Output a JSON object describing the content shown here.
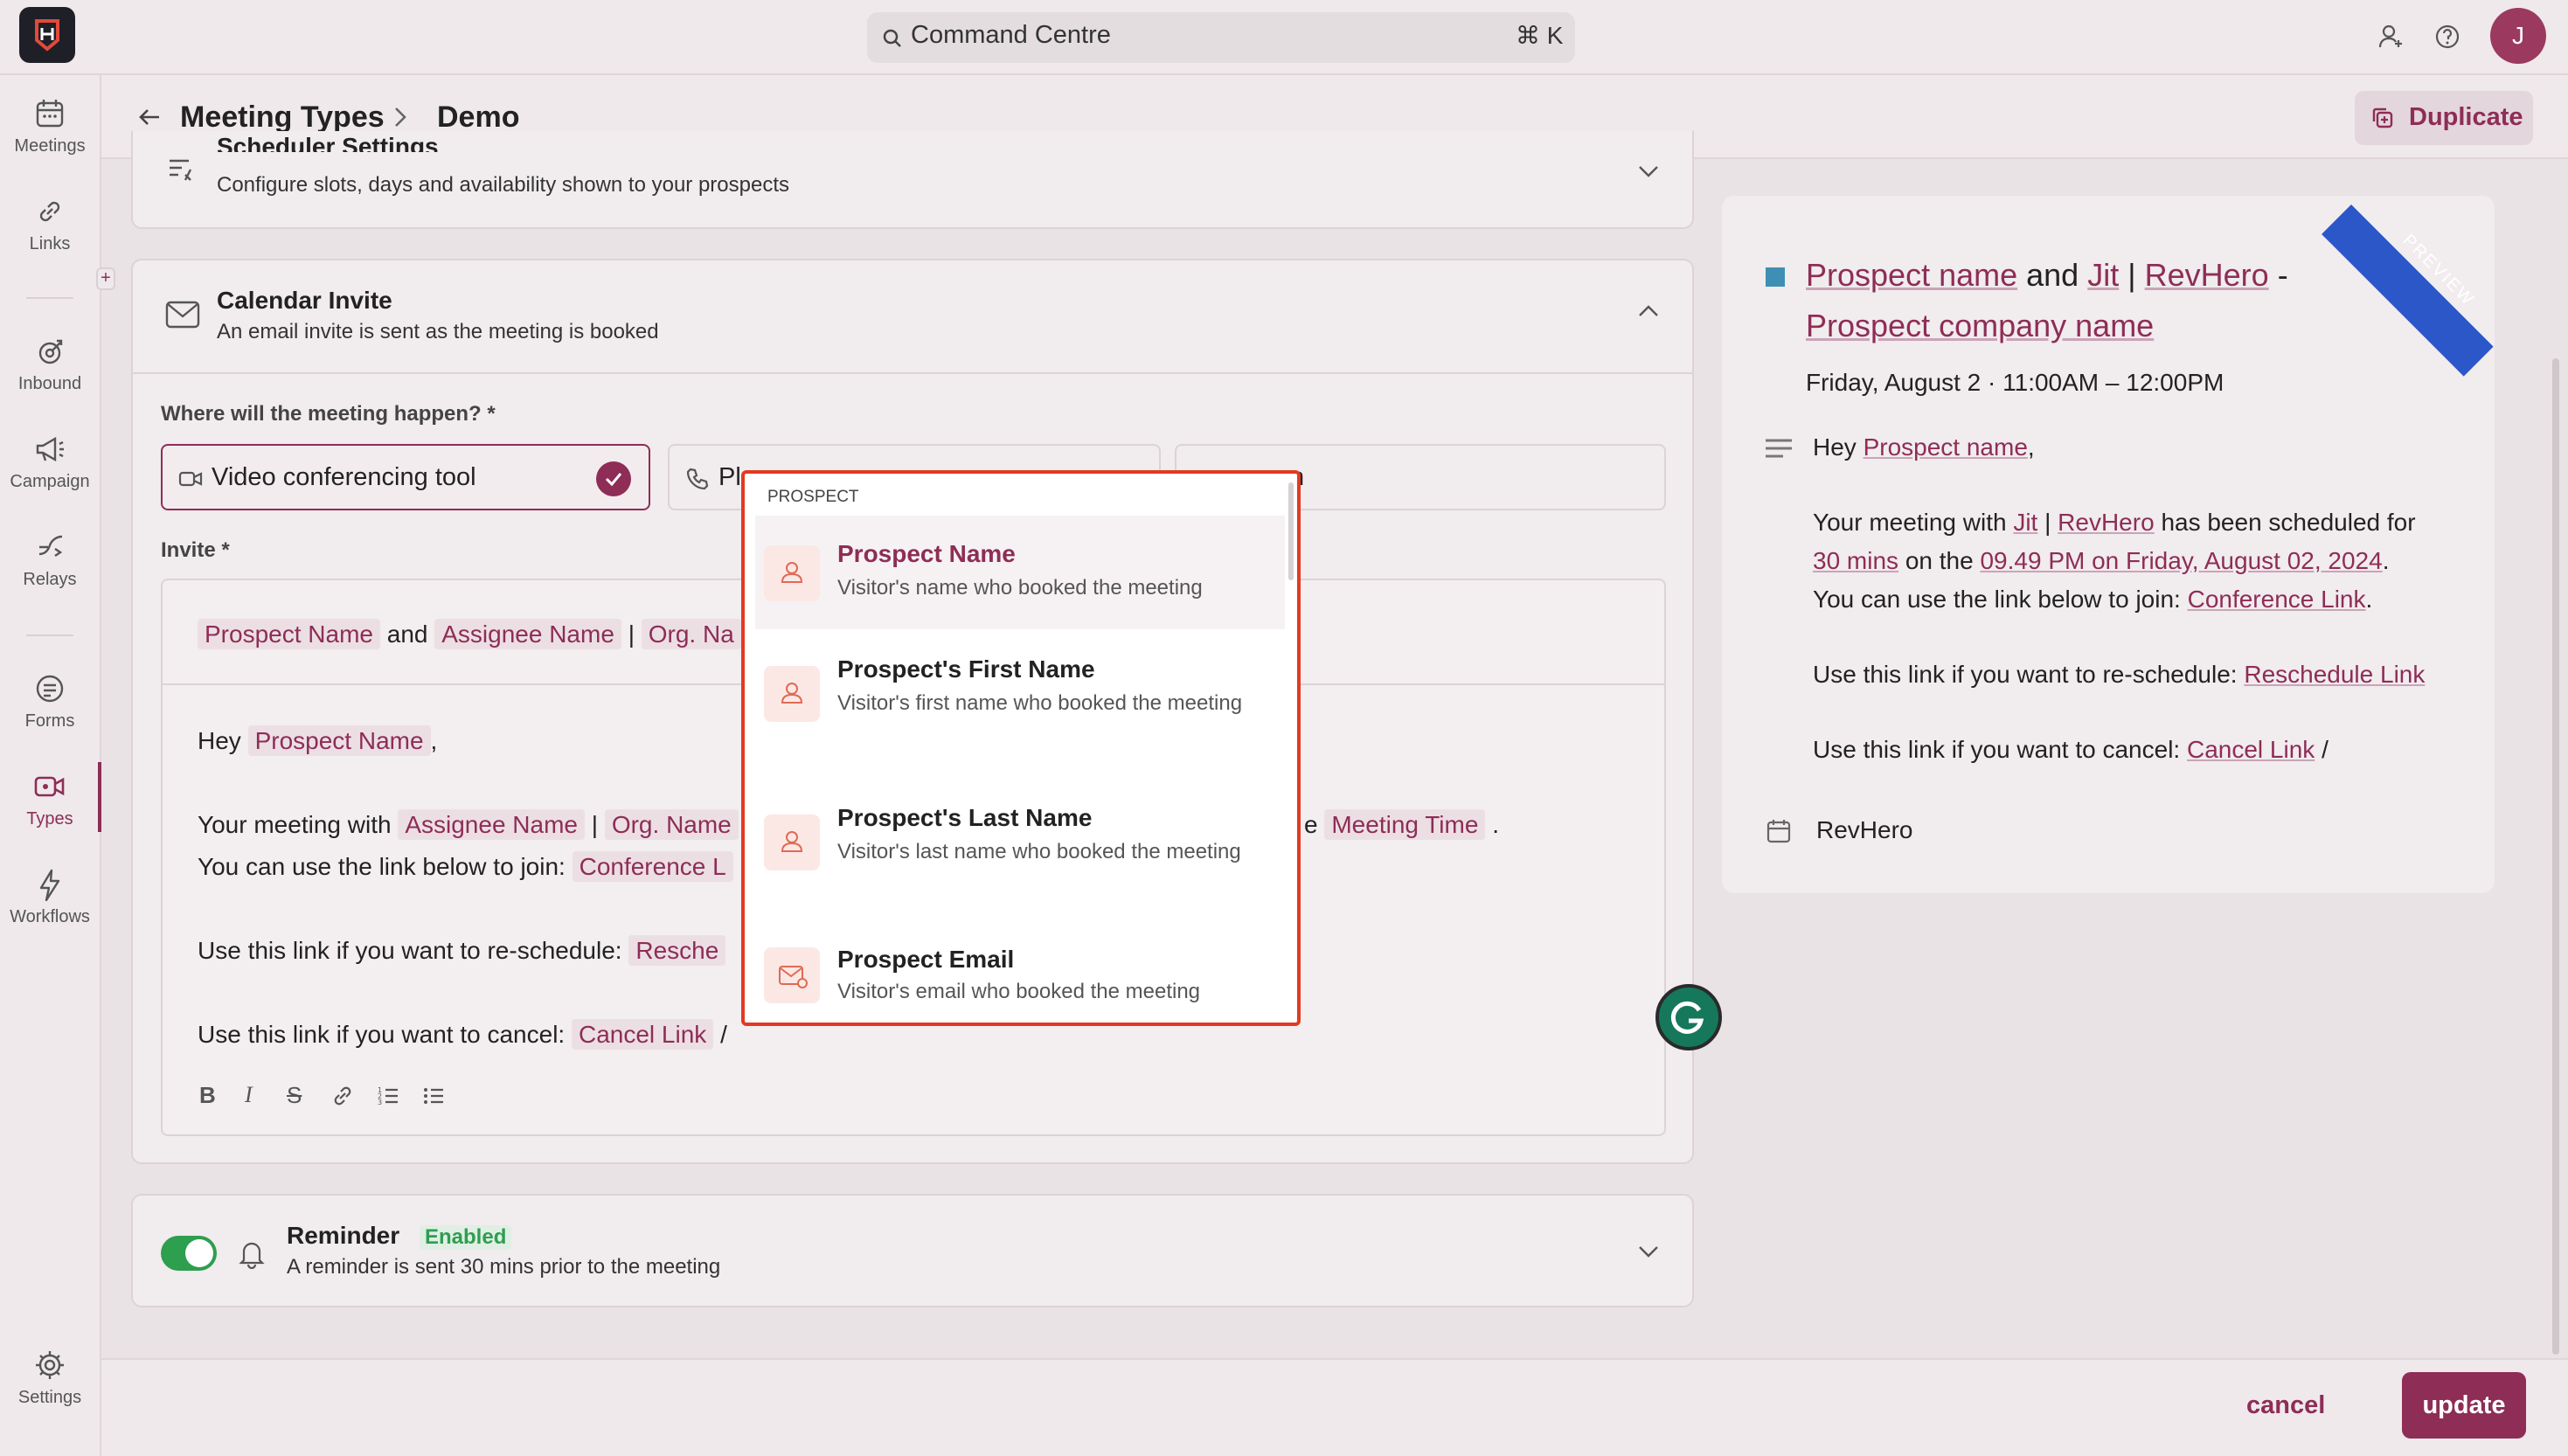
{
  "topbar": {
    "search_label": "Command Centre",
    "search_shortcut": "⌘ K",
    "avatar_initial": "J"
  },
  "sidebar": {
    "items": [
      {
        "label": "Meetings",
        "icon": "calendar-icon"
      },
      {
        "label": "Links",
        "icon": "link-icon"
      },
      {
        "label": "Inbound",
        "icon": "inbound-icon"
      },
      {
        "label": "Campaign",
        "icon": "megaphone-icon"
      },
      {
        "label": "Relays",
        "icon": "relay-icon"
      },
      {
        "label": "Forms",
        "icon": "form-icon"
      },
      {
        "label": "Types",
        "icon": "video-icon"
      },
      {
        "label": "Workflows",
        "icon": "bolt-icon"
      },
      {
        "label": "Settings",
        "icon": "gear-icon"
      }
    ]
  },
  "header": {
    "crumb_parent": "Meeting Types",
    "crumb_current": "Demo",
    "duplicate_label": "Duplicate"
  },
  "scheduler": {
    "title": "Scheduler Settings",
    "subtitle": "Configure slots, days and availability shown to your prospects"
  },
  "calendar_invite": {
    "title": "Calendar Invite",
    "subtitle": "An email invite is sent as the meeting is booked",
    "where_label": "Where will the meeting happen? *",
    "option_video": "Video conferencing tool",
    "option_phone_partial": "Pl",
    "option_third_partial": "n",
    "invite_label": "Invite *",
    "subject": {
      "var1": "Prospect Name",
      "and": "and",
      "var2": "Assignee Name",
      "pipe": "|",
      "var3_partial": "Org. Na"
    },
    "body": {
      "greeting_prefix": "Hey",
      "greeting_var": "Prospect Name",
      "greeting_suffix": ",",
      "line1_prefix": "Your meeting with",
      "line1_var1": "Assignee Name",
      "line1_pipe": "|",
      "line1_var2_partial": "Org. Name",
      "line1_suffix_partial": "e",
      "line1_var3": "Meeting Time",
      "line1_end": ".",
      "line2_prefix": "You can use the link below to join:",
      "line2_var_partial": "Conference L",
      "line3_prefix": "Use this link if you want to re-schedule:",
      "line3_var_partial": "Resche",
      "line4_prefix": "Use this link if you want to cancel:",
      "line4_var": "Cancel Link",
      "line4_suffix": "/"
    }
  },
  "dropdown": {
    "section": "PROSPECT",
    "items": [
      {
        "title": "Prospect Name",
        "desc": "Visitor's name who booked the meeting"
      },
      {
        "title": "Prospect's First Name",
        "desc": "Visitor's first name who booked the meeting"
      },
      {
        "title": "Prospect's Last Name",
        "desc": "Visitor's last name who booked the meeting"
      },
      {
        "title": "Prospect Email",
        "desc": "Visitor's email who booked the meeting"
      }
    ]
  },
  "reminder": {
    "title": "Reminder",
    "badge": "Enabled",
    "subtitle": "A reminder is sent 30 mins prior to the meeting"
  },
  "preview": {
    "ribbon": "PREVIEW",
    "title_var1": "Prospect name",
    "title_and": "and",
    "title_var2": "Jit",
    "title_pipe": "|",
    "title_var3": "RevHero",
    "title_dash": "-",
    "title_var4": "Prospect company name",
    "datetime": "Friday, August 2 · 11:00AM – 12:00PM",
    "greeting_prefix": "Hey",
    "greeting_var": "Prospect name",
    "greeting_suffix": ",",
    "line1_prefix": "Your meeting with",
    "line1_var1": "Jit",
    "line1_pipe": "|",
    "line1_var2": "RevHero",
    "line1_mid": "has been scheduled for",
    "line1b_var1": "30 mins",
    "line1b_mid": "on the",
    "line1b_var2": "09.49 PM on Friday, August 02, 2024",
    "line1b_end": ".",
    "line2_prefix": "You can use the link below to join:",
    "line2_var": "Conference Link",
    "line2_end": ".",
    "line3_prefix": "Use this link if you want to re-schedule:",
    "line3_var": "Reschedule Link",
    "line4_prefix": "Use this link if you want to cancel:",
    "line4_var": "Cancel Link",
    "line4_suffix": "/",
    "organizer": "RevHero"
  },
  "footer": {
    "cancel_label": "cancel",
    "update_label": "update"
  },
  "colors": {
    "brand": "#8e2d56",
    "highlight_border": "#e23a22",
    "enabled_green": "#2e9e4f"
  }
}
